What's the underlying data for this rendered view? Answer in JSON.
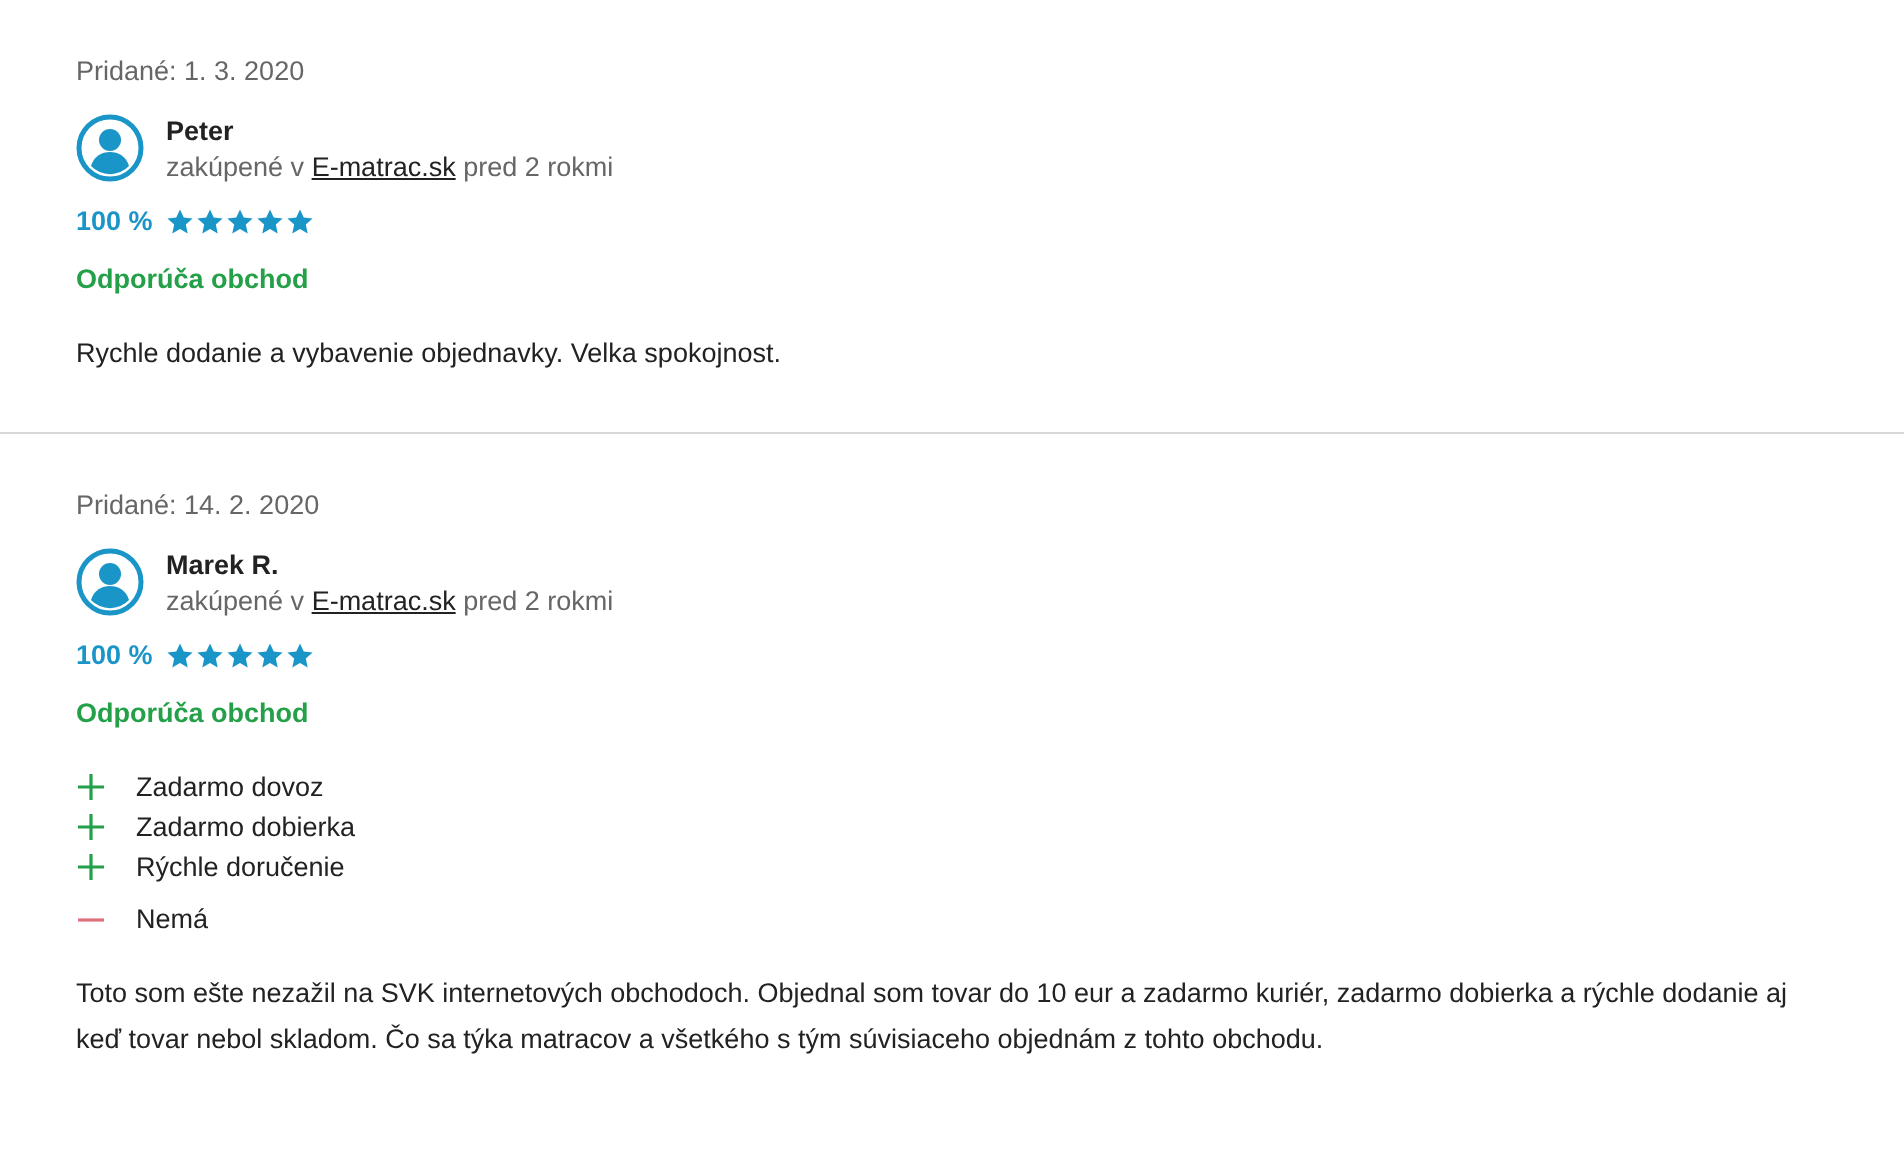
{
  "reviews": [
    {
      "date": "Pridané: 1. 3. 2020",
      "author": "Peter",
      "purchase_prefix": "zakúpené v",
      "shop": "E-matrac.sk",
      "purchase_suffix": "pred 2 rokmi",
      "score": "100 %",
      "stars": 5,
      "recommendation": "Odporúča obchod",
      "text": "Rychle dodanie a vybavenie objednavky. Velka spokojnost."
    },
    {
      "date": "Pridané: 14. 2. 2020",
      "author": "Marek R.",
      "purchase_prefix": "zakúpené v",
      "shop": "E-matrac.sk",
      "purchase_suffix": "pred 2 rokmi",
      "score": "100 %",
      "stars": 5,
      "recommendation": "Odporúča obchod",
      "points": [
        {
          "kind": "pro",
          "text": "Zadarmo dovoz"
        },
        {
          "kind": "pro",
          "text": "Zadarmo dobierka"
        },
        {
          "kind": "pro",
          "text": "Rýchle doručenie"
        },
        {
          "kind": "con",
          "text": "Nemá"
        }
      ],
      "text": "Toto som ešte nezažil na SVK internetových obchodoch. Objednal som tovar do 10 eur a zadarmo kuriér, zadarmo dobierka a rýchle dodanie aj keď tovar nebol skladom. Čo sa týka matracov a všetkého s tým súvisiaceho objednám z tohto obchodu."
    }
  ]
}
